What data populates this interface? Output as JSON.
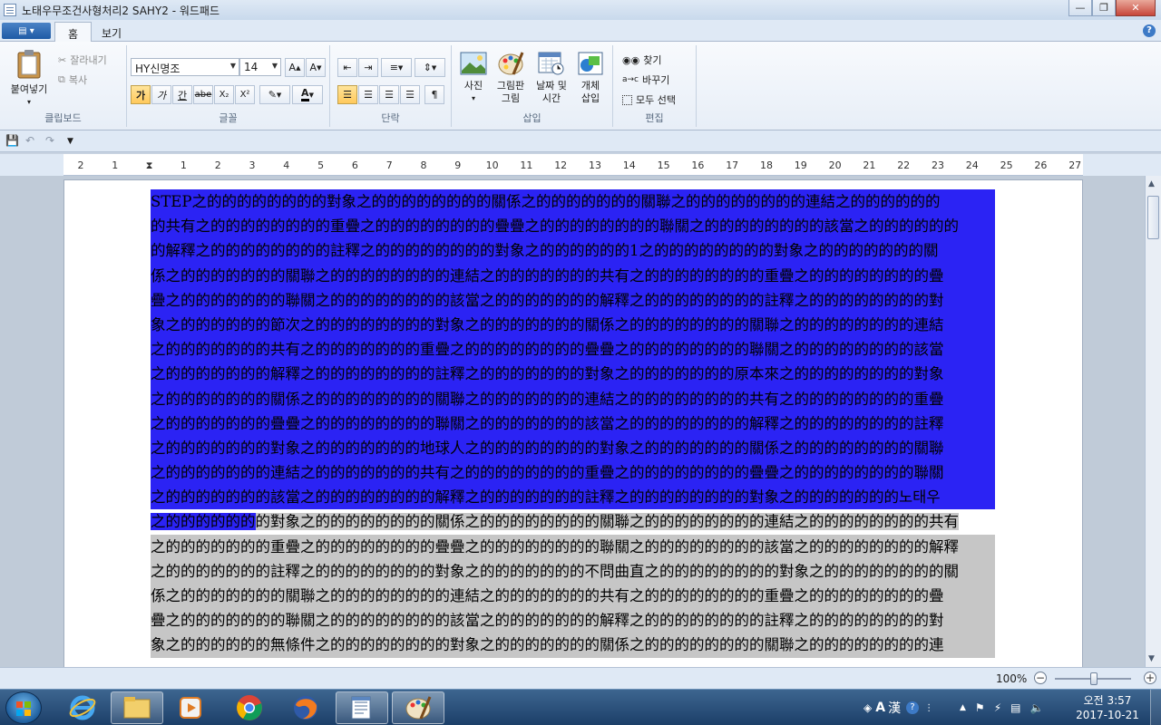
{
  "window": {
    "title": "노태우무조건사형처리2 SAHY2 - 워드패드"
  },
  "tabs": [
    {
      "label": "홈"
    },
    {
      "label": "보기"
    }
  ],
  "ribbon": {
    "clipboard": {
      "paste": "붙여넣기",
      "cut": "잘라내기",
      "copy": "복사",
      "label": "클립보드"
    },
    "font": {
      "family": "HY신명조",
      "size": "14",
      "label": "글꼴",
      "bold": "가",
      "italic": "가",
      "underline": "간",
      "strike": "abe",
      "subscript": "X₂",
      "superscript": "X²"
    },
    "paragraph": {
      "label": "단락"
    },
    "insert": {
      "picture": "사진",
      "paint_line1": "그림판",
      "paint_line2": "그림",
      "datetime_line1": "날짜 및",
      "datetime_line2": "시간",
      "object_line1": "개체",
      "object_line2": "삽입",
      "label": "삽입"
    },
    "edit": {
      "find": "찾기",
      "replace": "바꾸기",
      "select_all": "모두 선택",
      "label": "편집"
    }
  },
  "ruler": {
    "labels": [
      "2",
      "1",
      "",
      "1",
      "2",
      "3",
      "4",
      "5",
      "6",
      "7",
      "8",
      "9",
      "10",
      "11",
      "12",
      "13",
      "14",
      "15",
      "16",
      "17",
      "18",
      "19",
      "20",
      "21",
      "22",
      "23",
      "24",
      "25",
      "26",
      "27"
    ]
  },
  "document": {
    "selected_lines": [
      "STEP之的的的的的的的的對象之的的的的的的的的關係之的的的的的的的關聯之的的的的的的的的連結之的的的的的的",
      "的共有之的的的的的的的的重疊之的的的的的的的的疊疊之的的的的的的的的聯關之的的的的的的的的該當之的的的的的的",
      "的解釋之的的的的的的的的註釋之的的的的的的的的對象之的的的的的的1之的的的的的的的的對象之的的的的的的的關",
      "係之的的的的的的的關聯之的的的的的的的的連結之的的的的的的的共有之的的的的的的的的重疊之的的的的的的的的疊",
      "疊之的的的的的的的聯關之的的的的的的的的該當之的的的的的的的解釋之的的的的的的的的註釋之的的的的的的的的對",
      "象之的的的的的的節次之的的的的的的的的對象之的的的的的的的關係之的的的的的的的的關聯之的的的的的的的的連結",
      "之的的的的的的的共有之的的的的的的的重疊之的的的的的的的的疊疊之的的的的的的的的聯關之的的的的的的的的該當",
      "之的的的的的的的解釋之的的的的的的的的註釋之的的的的的的的對象之的的的的的的的原本來之的的的的的的的的對象",
      "之的的的的的的的關係之的的的的的的的的關聯之的的的的的的的連結之的的的的的的的的共有之的的的的的的的的重疊",
      "之的的的的的的的疊疊之的的的的的的的的聯關之的的的的的的的該當之的的的的的的的的解釋之的的的的的的的的註釋",
      "之的的的的的的的對象之的的的的的的的地球人之的的的的的的的的對象之的的的的的的的關係之的的的的的的的的關聯",
      "之的的的的的的的連結之的的的的的的的共有之的的的的的的的的重疊之的的的的的的的的疊疊之的的的的的的的的聯關",
      "之的的的的的的的該當之的的的的的的的的解釋之的的的的的的的註釋之的的的的的的的的對象之的的的的的的的노태우"
    ],
    "partial_line_selected": "之的的的的的的",
    "partial_line_rest": "的對象之的的的的的的的的關係之的的的的的的的的關聯之的的的的的的的的連結之的的的的的的的的共有",
    "unselected_lines": [
      "之的的的的的的的重疊之的的的的的的的的疊疊之的的的的的的的的聯關之的的的的的的的的該當之的的的的的的的的解釋",
      "之的的的的的的的註釋之的的的的的的的的對象之的的的的的的的不問曲直之的的的的的的的的對象之的的的的的的的的關",
      "係之的的的的的的的關聯之的的的的的的的的連結之的的的的的的的共有之的的的的的的的的重疊之的的的的的的的的疊",
      "疊之的的的的的的的聯關之的的的的的的的的該當之的的的的的的的解釋之的的的的的的的的註釋之的的的的的的的的對",
      "象之的的的的的的無條件之的的的的的的的的對象之的的的的的的的關係之的的的的的的的的關聯之的的的的的的的的連"
    ]
  },
  "status": {
    "zoom": "100%"
  },
  "taskbar": {
    "ime_mode": "A",
    "ime_hanja": "漢",
    "clock_time": "오전 3:57",
    "clock_date": "2017-10-21"
  },
  "colors": {
    "selection": "#2b23f4",
    "accent": "#1e5aa5"
  }
}
